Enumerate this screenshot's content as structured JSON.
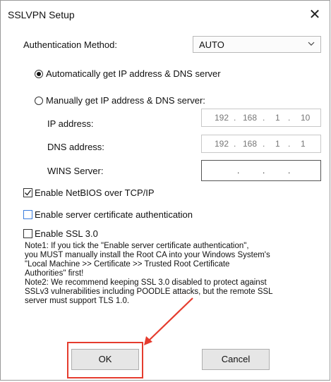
{
  "window": {
    "title": "SSLVPN Setup",
    "close_glyph": "✕"
  },
  "auth": {
    "label": "Authentication Method:",
    "value": "AUTO"
  },
  "radios": {
    "auto_label": "Automatically get IP address & DNS server",
    "manual_label": "Manually get IP address & DNS server:"
  },
  "fields": {
    "ip": {
      "label": "IP address:",
      "octets": [
        "192",
        "168",
        "1",
        "10"
      ]
    },
    "dns": {
      "label": "DNS address:",
      "octets": [
        "192",
        "168",
        "1",
        "1"
      ]
    },
    "wins": {
      "label": "WINS Server:",
      "octets": [
        "",
        "",
        "",
        ""
      ]
    }
  },
  "checkboxes": {
    "netbios": {
      "label": "Enable NetBIOS over TCP/IP",
      "checked": true
    },
    "server_cert": {
      "label": "Enable server certificate authentication",
      "checked": false
    },
    "ssl3": {
      "label": "Enable SSL 3.0",
      "checked": false
    }
  },
  "notes": {
    "line1": "Note1: If you tick the \"Enable server certificate authentication\",",
    "line2": "you MUST manually install the Root CA into your Windows System's",
    "line3": "\"Local Machine >> Certificate >> Trusted Root Certificate",
    "line4": "Authorities\" first!",
    "line5": "Note2: We recommend keeping SSL 3.0 disabled to protect against",
    "line6": "SSLv3 vulnerabilities including POODLE attacks, but the remote SSL",
    "line7": "server must support TLS 1.0."
  },
  "buttons": {
    "ok": "OK",
    "cancel": "Cancel"
  },
  "colors": {
    "highlight": "#e53c2e",
    "focus_blue": "#3b7ddd"
  }
}
